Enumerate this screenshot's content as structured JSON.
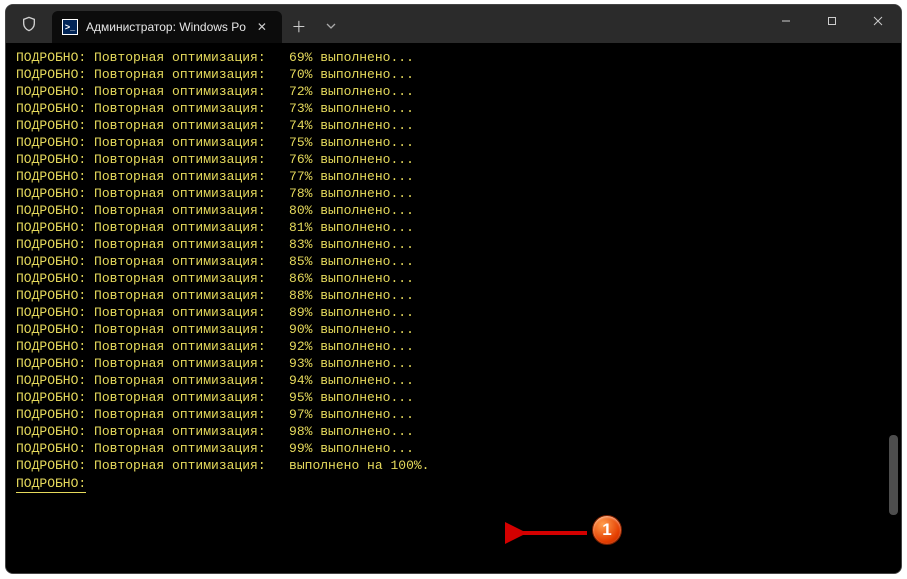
{
  "tab": {
    "icon_glyph": ">_",
    "title": "Администратор: Windows Po"
  },
  "terminal": {
    "prefix": "ПОДРОБНО: Повторная оптимизация:",
    "suffix": "выполнено...",
    "percents": [
      69,
      70,
      72,
      73,
      74,
      75,
      76,
      77,
      78,
      80,
      81,
      83,
      85,
      86,
      88,
      89,
      90,
      92,
      93,
      94,
      95,
      97,
      98,
      99
    ],
    "final_line": "ПОДРОБНО: Повторная оптимизация:   выполнено на 100%.",
    "tail": "ПОДРОБНО:"
  },
  "annotation": {
    "number": "1"
  }
}
